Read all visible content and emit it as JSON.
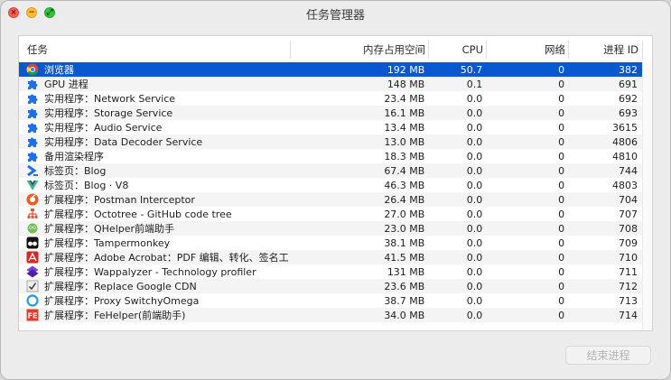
{
  "window": {
    "title": "任务管理器"
  },
  "columns": {
    "task": "任务",
    "memory": "内存占用空间",
    "cpu": "CPU",
    "network": "网络",
    "pid": "进程 ID"
  },
  "rows": [
    {
      "name": "浏览器",
      "memory": "192 MB",
      "cpu": "50.7",
      "network": "0",
      "pid": "382",
      "icon": "chrome-icon",
      "selected": true
    },
    {
      "name": "GPU 进程",
      "memory": "148 MB",
      "cpu": "0.1",
      "network": "0",
      "pid": "691",
      "icon": "puzzle-icon"
    },
    {
      "name": "实用程序：Network Service",
      "memory": "23.4 MB",
      "cpu": "0.0",
      "network": "0",
      "pid": "692",
      "icon": "puzzle-icon"
    },
    {
      "name": "实用程序：Storage Service",
      "memory": "16.1 MB",
      "cpu": "0.0",
      "network": "0",
      "pid": "693",
      "icon": "puzzle-icon"
    },
    {
      "name": "实用程序：Audio Service",
      "memory": "13.4 MB",
      "cpu": "0.0",
      "network": "0",
      "pid": "3615",
      "icon": "puzzle-icon"
    },
    {
      "name": "实用程序：Data Decoder Service",
      "memory": "13.0 MB",
      "cpu": "0.0",
      "network": "0",
      "pid": "4806",
      "icon": "puzzle-icon"
    },
    {
      "name": "备用渲染程序",
      "memory": "18.3 MB",
      "cpu": "0.0",
      "network": "0",
      "pid": "4810",
      "icon": "puzzle-icon"
    },
    {
      "name": "标签页：Blog",
      "memory": "67.4 MB",
      "cpu": "0.0",
      "network": "0",
      "pid": "744",
      "icon": "blog-chevron-icon"
    },
    {
      "name": "标签页：Blog · V8",
      "memory": "46.3 MB",
      "cpu": "0.0",
      "network": "0",
      "pid": "4803",
      "icon": "vue-icon"
    },
    {
      "name": "扩展程序：Postman Interceptor",
      "memory": "26.4 MB",
      "cpu": "0.0",
      "network": "0",
      "pid": "704",
      "icon": "postman-icon"
    },
    {
      "name": "扩展程序：Octotree - GitHub code tree",
      "memory": "27.0 MB",
      "cpu": "0.0",
      "network": "0",
      "pid": "707",
      "icon": "octotree-icon"
    },
    {
      "name": "扩展程序：QHelper前端助手",
      "memory": "23.0 MB",
      "cpu": "0.0",
      "network": "0",
      "pid": "708",
      "icon": "qhelper-icon"
    },
    {
      "name": "扩展程序：Tampermonkey",
      "memory": "38.1 MB",
      "cpu": "0.0",
      "network": "0",
      "pid": "709",
      "icon": "tampermonkey-icon"
    },
    {
      "name": "扩展程序：Adobe Acrobat：PDF 编辑、转化、签名工",
      "memory": "41.5 MB",
      "cpu": "0.0",
      "network": "0",
      "pid": "710",
      "icon": "acrobat-icon"
    },
    {
      "name": "扩展程序：Wappalyzer - Technology profiler",
      "memory": "131 MB",
      "cpu": "0.0",
      "network": "0",
      "pid": "711",
      "icon": "wappalyzer-icon"
    },
    {
      "name": "扩展程序：Replace Google CDN",
      "memory": "23.6 MB",
      "cpu": "0.0",
      "network": "0",
      "pid": "712",
      "icon": "replace-cdn-icon"
    },
    {
      "name": "扩展程序：Proxy SwitchyOmega",
      "memory": "38.7 MB",
      "cpu": "0.0",
      "network": "0",
      "pid": "713",
      "icon": "switchyomega-icon"
    },
    {
      "name": "扩展程序：FeHelper(前端助手)",
      "memory": "34.0 MB",
      "cpu": "0.0",
      "network": "0",
      "pid": "714",
      "icon": "fehelper-icon"
    }
  ],
  "actions": {
    "end_process": "结束进程"
  }
}
